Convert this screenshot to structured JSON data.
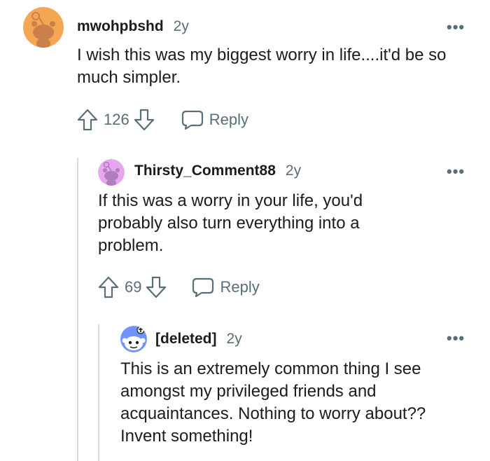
{
  "comments": [
    {
      "username": "mwohpbshd",
      "age": "2y",
      "body": "I wish this was my biggest worry in life....it'd be so much simpler.",
      "votes": "126",
      "reply_label": "Reply",
      "more_label": "•••",
      "avatar_color": "#f4a653"
    },
    {
      "username": "Thirsty_Comment88",
      "age": "2y",
      "body": "If this was a worry in your life, you'd probably also turn everything into a problem.",
      "votes": "69",
      "reply_label": "Reply",
      "more_label": "•••",
      "avatar_color": "#e6a6f0"
    },
    {
      "username": "[deleted]",
      "age": "2y",
      "body": "This is an extremely common thing I see amongst my privileged friends and acquaintances. Nothing to worry about?? Invent something!",
      "more_label": "•••",
      "avatar_color": "#7193ff"
    }
  ]
}
